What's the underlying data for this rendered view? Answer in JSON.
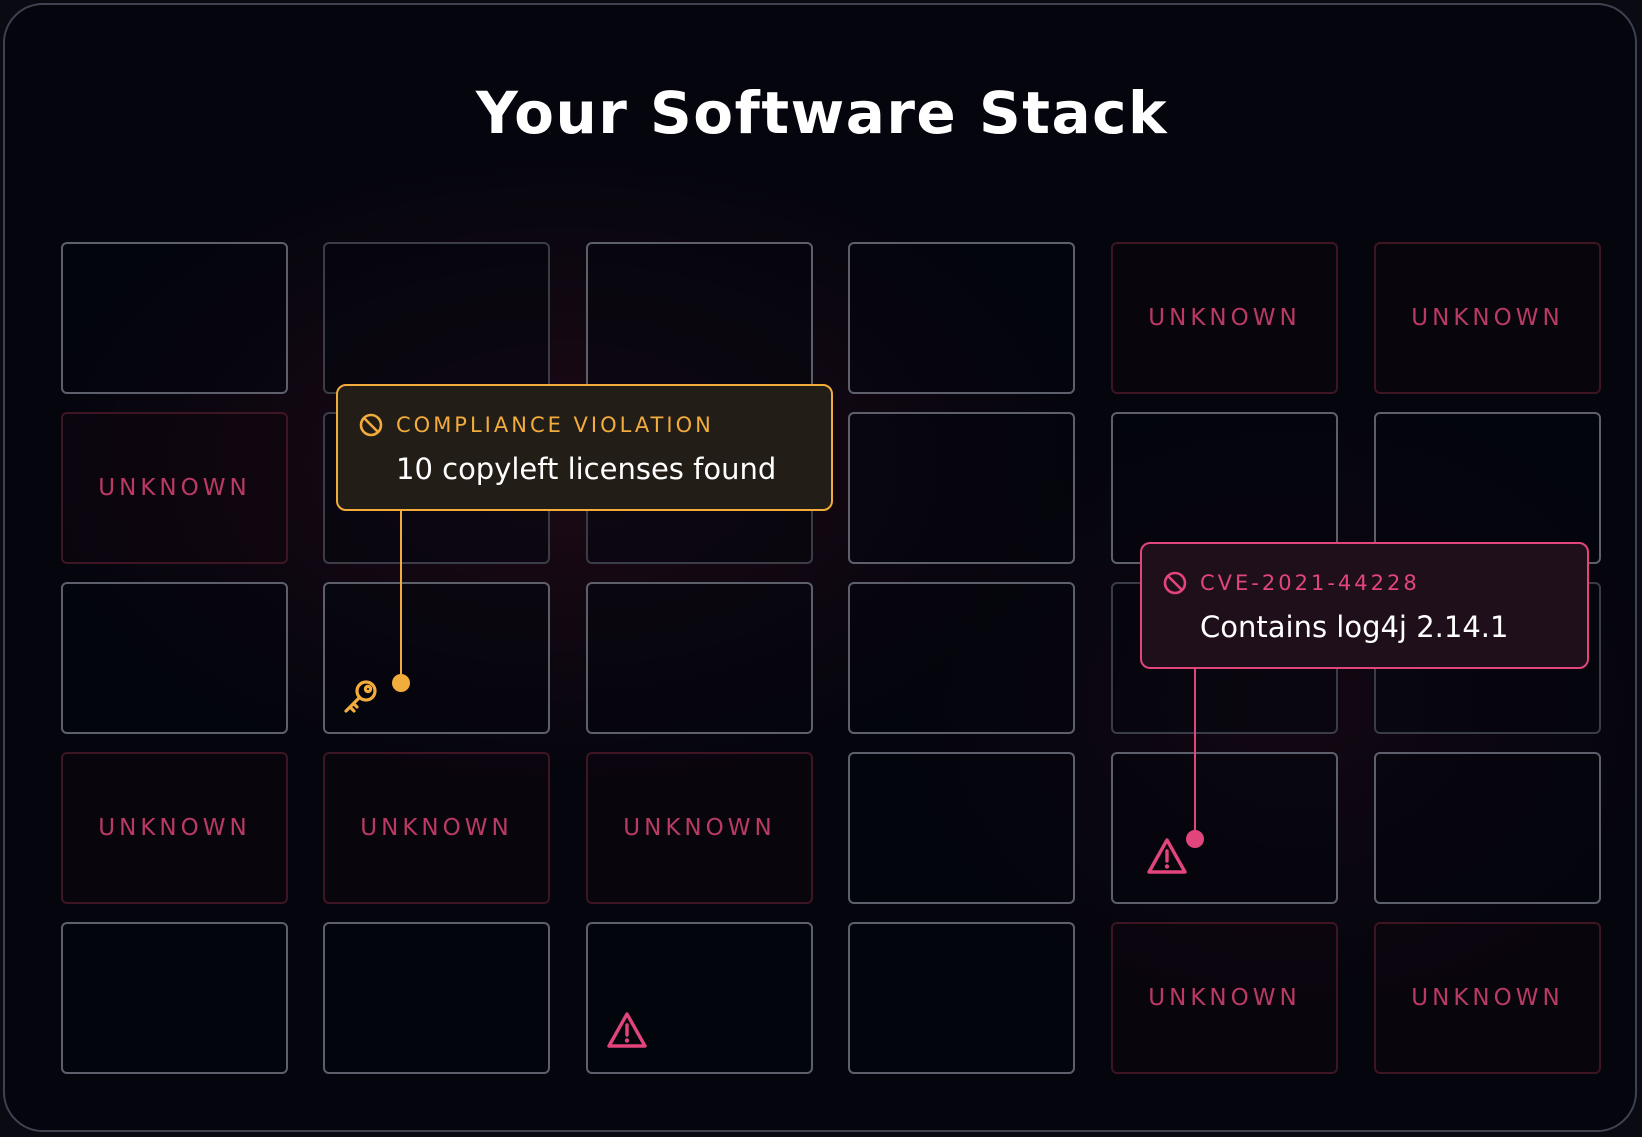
{
  "title": "Your Software Stack",
  "grid": {
    "tiles": [
      {
        "label": "",
        "state": "normal"
      },
      {
        "label": "",
        "state": "dim"
      },
      {
        "label": "",
        "state": "normal"
      },
      {
        "label": "",
        "state": "normal"
      },
      {
        "label": "UNKNOWN",
        "state": "unknown"
      },
      {
        "label": "UNKNOWN",
        "state": "unknown"
      },
      {
        "label": "UNKNOWN",
        "state": "unknown"
      },
      {
        "label": "",
        "state": "dim"
      },
      {
        "label": "",
        "state": "dim"
      },
      {
        "label": "",
        "state": "normal"
      },
      {
        "label": "",
        "state": "normal"
      },
      {
        "label": "",
        "state": "normal"
      },
      {
        "label": "",
        "state": "normal"
      },
      {
        "label": "",
        "state": "normal"
      },
      {
        "label": "",
        "state": "normal"
      },
      {
        "label": "",
        "state": "normal"
      },
      {
        "label": "",
        "state": "dim"
      },
      {
        "label": "",
        "state": "dim"
      },
      {
        "label": "UNKNOWN",
        "state": "unknown"
      },
      {
        "label": "UNKNOWN",
        "state": "unknown"
      },
      {
        "label": "UNKNOWN",
        "state": "unknown"
      },
      {
        "label": "",
        "state": "normal"
      },
      {
        "label": "",
        "state": "normal"
      },
      {
        "label": "",
        "state": "normal"
      },
      {
        "label": "",
        "state": "normal"
      },
      {
        "label": "",
        "state": "normal"
      },
      {
        "label": "",
        "state": "normal"
      },
      {
        "label": "",
        "state": "normal"
      },
      {
        "label": "UNKNOWN",
        "state": "unknown"
      },
      {
        "label": "UNKNOWN",
        "state": "unknown"
      }
    ]
  },
  "compliance_callout": {
    "icon": "ban-icon",
    "tag": "COMPLIANCE VIOLATION",
    "message": "10 copyleft licenses found",
    "marker_icon": "key-icon"
  },
  "cve_callout": {
    "icon": "ban-icon",
    "tag": "CVE-2021-44228",
    "message": "Contains log4j 2.14.1",
    "marker_icon": "warning-icon"
  },
  "extra_marker": {
    "icon": "warning-icon"
  },
  "colors": {
    "background": "#04050d",
    "compliance": "#f2ac3c",
    "vulnerability": "#e2457b",
    "unknown_text": "#b93a62"
  }
}
